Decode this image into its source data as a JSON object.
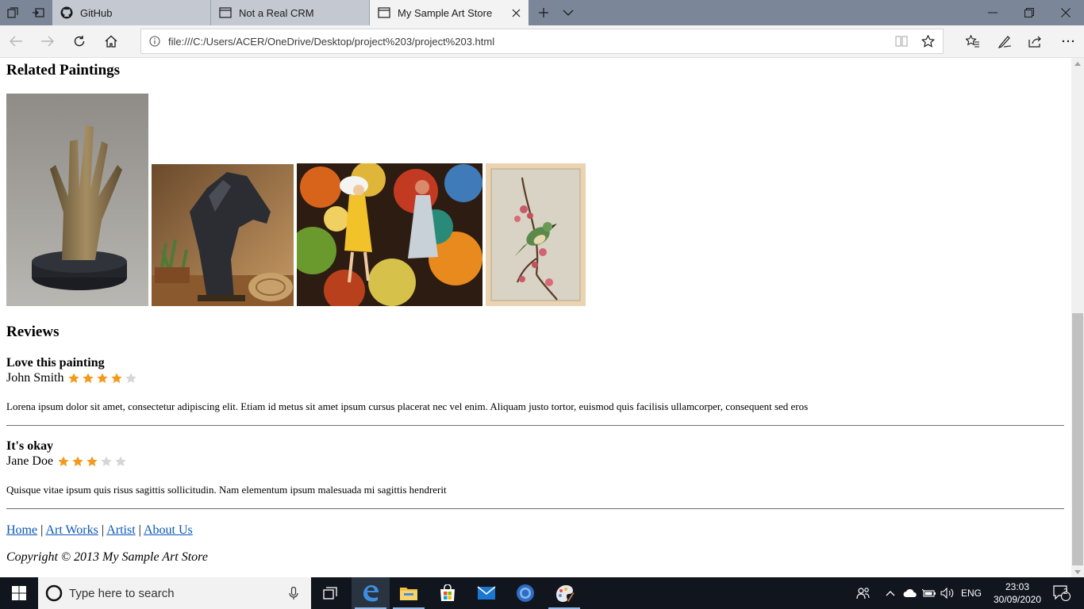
{
  "browser": {
    "tabs": [
      {
        "title": "GitHub",
        "icon": "github-icon",
        "active": false
      },
      {
        "title": "Not a Real CRM",
        "icon": "page-icon",
        "active": false
      },
      {
        "title": "My Sample Art Store",
        "icon": "page-icon",
        "active": true
      }
    ],
    "url": "file:///C:/Users/ACER/OneDrive/Desktop/project%203/project%203.html"
  },
  "page": {
    "related_heading": "Related Paintings",
    "related_images": [
      {
        "subject": "bronze hand sculpture"
      },
      {
        "subject": "bronze horse head sculpture"
      },
      {
        "subject": "colorful painting of girls in garden"
      },
      {
        "subject": "bird on blossom branch print"
      }
    ],
    "reviews_heading": "Reviews",
    "reviews": [
      {
        "title": "Love this painting",
        "author": "John Smith",
        "rating": 4,
        "max_rating": 5,
        "body": "Lorena ipsum dolor sit amet, consectetur adipiscing elit. Etiam id metus sit amet ipsum cursus placerat nec vel enim. Aliquam justo tortor, euismod quis facilisis ullamcorper, consequent sed eros"
      },
      {
        "title": "It's okay",
        "author": "Jane Doe",
        "rating": 3,
        "max_rating": 5,
        "body": "Quisque vitae ipsum quis risus sagittis sollicitudin. Nam elementum ipsum malesuada mi sagittis hendrerit"
      }
    ],
    "footer": {
      "links": [
        "Home",
        "Art Works",
        "Artist",
        "About Us"
      ],
      "separator": "|",
      "copyright": "Copyright © 2013 My Sample Art Store"
    }
  },
  "taskbar": {
    "search_placeholder": "Type here to search",
    "language": "ENG",
    "time": "23:03",
    "date": "30/09/2020",
    "notification_count": "2"
  },
  "colors": {
    "star_filled": "#f39a1e",
    "star_empty": "#d6d6d6",
    "link": "#0b57b5",
    "tabbar": "#7b8798",
    "taskbar": "#11161e"
  }
}
